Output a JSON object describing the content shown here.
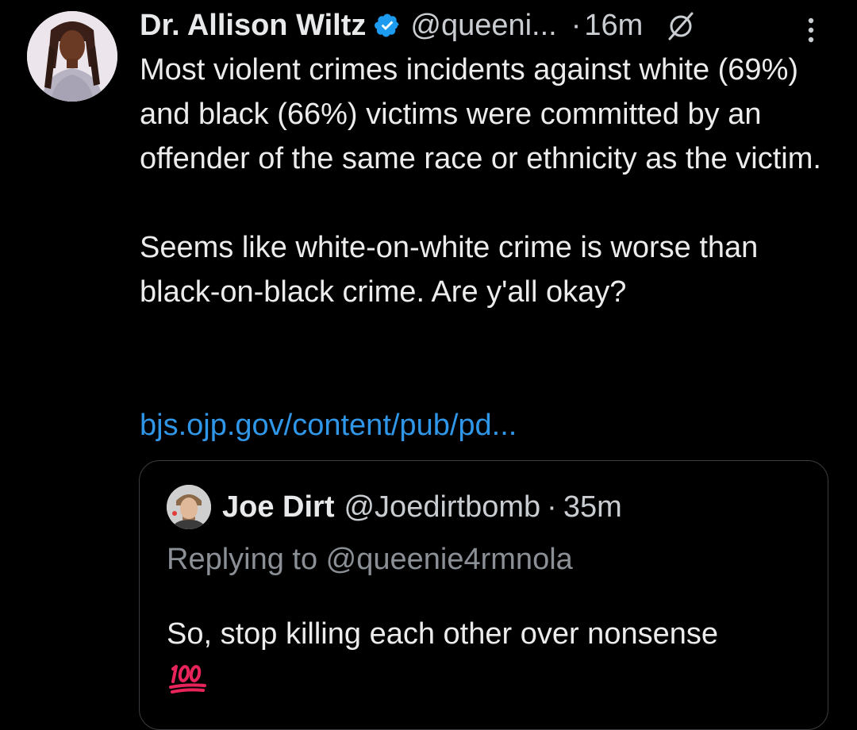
{
  "tweet": {
    "author": {
      "name": "Dr. Allison Wiltz",
      "handle": "@queeni...",
      "verified": true,
      "avatar_icon": "profile-photo"
    },
    "dot": "·",
    "time": "16m",
    "body": {
      "paragraph1": "Most violent crimes incidents  against white (69%) and black (66%) victims were committed by an offender of the same race or ethnicity as the victim.",
      "paragraph2": "Seems like white-on-white crime is worse than black-on-black crime. Are y'all okay?"
    },
    "link": "bjs.ojp.gov/content/pub/pd...",
    "icons": {
      "verified": "verified-badge-icon",
      "no_replies": "slash-circle-icon",
      "more": "more-vertical-icon"
    }
  },
  "quote": {
    "author": {
      "name": "Joe Dirt",
      "handle": "@Joedirtbomb",
      "avatar_icon": "profile-photo"
    },
    "dot": "·",
    "time": "35m",
    "replying_to": "Replying to @queenie4rmnola",
    "text": "So, stop killing each other over nonsense",
    "emoji": "💯"
  },
  "colors": {
    "background": "#000000",
    "text": "#e7e9ea",
    "muted": "#8b9096",
    "link": "#2f96e8",
    "verified": "#1d9bf0",
    "card_border": "#3a3d41"
  }
}
